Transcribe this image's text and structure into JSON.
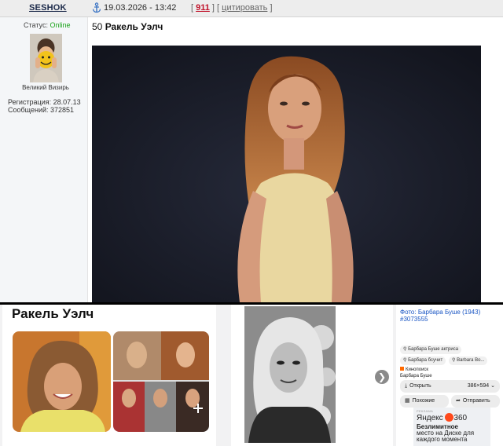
{
  "post": {
    "author": "SESHOK",
    "date": "19.03.2026 - 13:42",
    "post_number": "911",
    "quote": "цитировать",
    "status_label": "Статус:",
    "status_value": "Online",
    "rank": "Великий Визирь",
    "registration": "Регистрация: 28.07.13",
    "messages": "Сообщений: 372851",
    "title_number": "50",
    "title_name": "Ракель Уэлч"
  },
  "search": {
    "results_title": "Ракель Уэлч"
  },
  "info": {
    "photo_title": "Фото: Барбара Буше (1943)",
    "photo_tag": "#3073555",
    "chip1": "Барбара Буше актриса",
    "chip2": "Барбара бсучит",
    "chip3": "Barbara Bo...",
    "source_name": "Кинопоиск",
    "source_sub": "Барбара Буше",
    "open_label": "Открыть",
    "size_label": "386×594",
    "similar_label": "Похожие",
    "send_label": "Отправить",
    "ad_top": "РЕКЛАМА",
    "ad_brand": "Яндекс",
    "ad_badge": "360",
    "ad_line1": "Безлимитное",
    "ad_line2": "место на Диске для",
    "ad_line3": "каждого момента"
  }
}
